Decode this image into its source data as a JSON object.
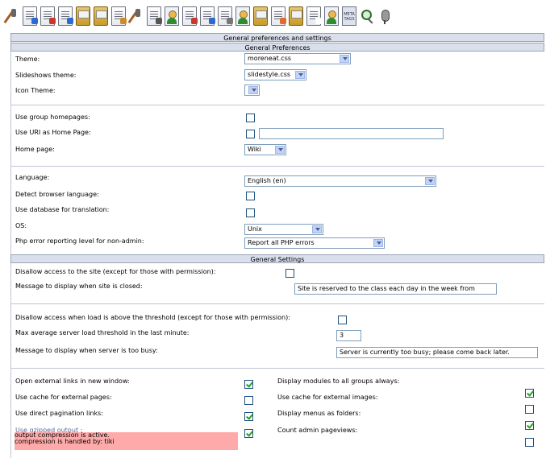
{
  "toolbar": {
    "icons": [
      "tools-icon",
      "page-icon",
      "export-icon",
      "document-icon",
      "folder-icon",
      "folder-open-icon",
      "edit-icon",
      "edit-doc-icon",
      "list-icon",
      "user-icon",
      "document-red-icon",
      "document-blue-icon",
      "frame-icon",
      "users-icon",
      "folder-user-icon",
      "document-orange-icon",
      "folder-green-icon",
      "document-plain-icon",
      "user-add-icon",
      "meta-tags-icon",
      "search-icon",
      "microphone-icon"
    ],
    "meta_label": "META TAGS"
  },
  "headers": {
    "main": "General preferences and settings",
    "preferences": "General Preferences",
    "settings": "General Settings"
  },
  "prefs": {
    "theme": {
      "label": "Theme:",
      "value": "moreneat.css"
    },
    "slideshow": {
      "label": "Slideshows theme:",
      "value": "slidestyle.css"
    },
    "icon_theme": {
      "label": "Icon Theme:",
      "value": ""
    },
    "group_home": {
      "label": "Use group homepages:",
      "checked": false
    },
    "uri_home": {
      "label": "Use URI as Home Page:",
      "checked": false,
      "value": ""
    },
    "home_page": {
      "label": "Home page:",
      "value": "Wiki"
    },
    "language": {
      "label": "Language:",
      "value": "English (en)"
    },
    "detect_lang": {
      "label": "Detect browser language:",
      "checked": false
    },
    "db_translation": {
      "label": "Use database for translation:",
      "checked": false
    },
    "os": {
      "label": "OS:",
      "value": "Unix"
    },
    "php_error": {
      "label": "Php error reporting level for non-admin:",
      "value": "Report all PHP errors"
    }
  },
  "settings": {
    "disallow": {
      "label": "Disallow access to the site (except for those with permission):",
      "checked": false
    },
    "closed_msg": {
      "label": "Message to display when site is closed:",
      "value": "Site is reserved to the class each day in the week from"
    },
    "disallow_load": {
      "label": "Disallow access when load is above the threshold (except for those with permission):",
      "checked": false
    },
    "max_load": {
      "label": "Max average server load threshold in the last minute:",
      "value": "3"
    },
    "busy_msg": {
      "label": "Message to display when server is too busy:",
      "value": "Server is currently too busy; please come back later."
    }
  },
  "options": {
    "left": [
      {
        "label": "Open external links in new window:",
        "checked": true
      },
      {
        "label": "Use cache for external pages:",
        "checked": false
      },
      {
        "label": "Use direct pagination links:",
        "checked": true
      },
      {
        "label": "Use gzipped output :",
        "checked": true
      }
    ],
    "right": [
      {
        "label": "Display modules to all groups always:",
        "checked": true
      },
      {
        "label": "Use cache for external images:",
        "checked": false
      },
      {
        "label": "Display menus as folders:",
        "checked": true
      },
      {
        "label": "Count admin pageviews:",
        "checked": false
      }
    ]
  },
  "gzip_status": {
    "line1": "output compression is active.",
    "line2": "compression is handled by: tiki"
  }
}
